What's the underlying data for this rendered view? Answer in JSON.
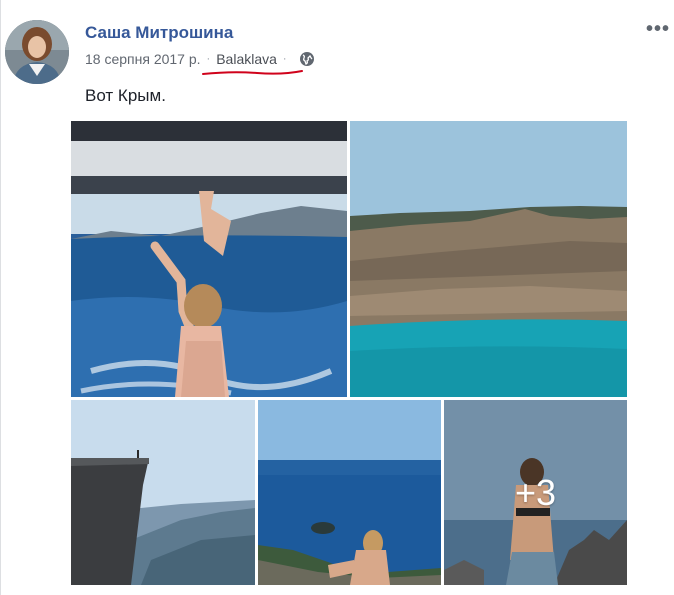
{
  "post": {
    "author": "Саша Митрошина",
    "date": "18 серпня 2017 р.",
    "separator": "·",
    "location": "Balaklava",
    "privacy_icon": "globe-icon",
    "options_icon": "more-options-icon",
    "options_label": "•••",
    "text": "Вот Крым."
  },
  "photos": {
    "items": [
      {
        "alt": "woman-on-boat-sea-photo"
      },
      {
        "alt": "quarry-turquoise-lake-photo"
      },
      {
        "alt": "cliff-edge-mountains-photo"
      },
      {
        "alt": "woman-sitting-sea-view-photo"
      },
      {
        "alt": "woman-on-rocks-photo"
      }
    ],
    "more_count": "+3"
  },
  "colors": {
    "author": "#365899",
    "meta": "#616770",
    "annotation_underline": "#d0021b"
  }
}
